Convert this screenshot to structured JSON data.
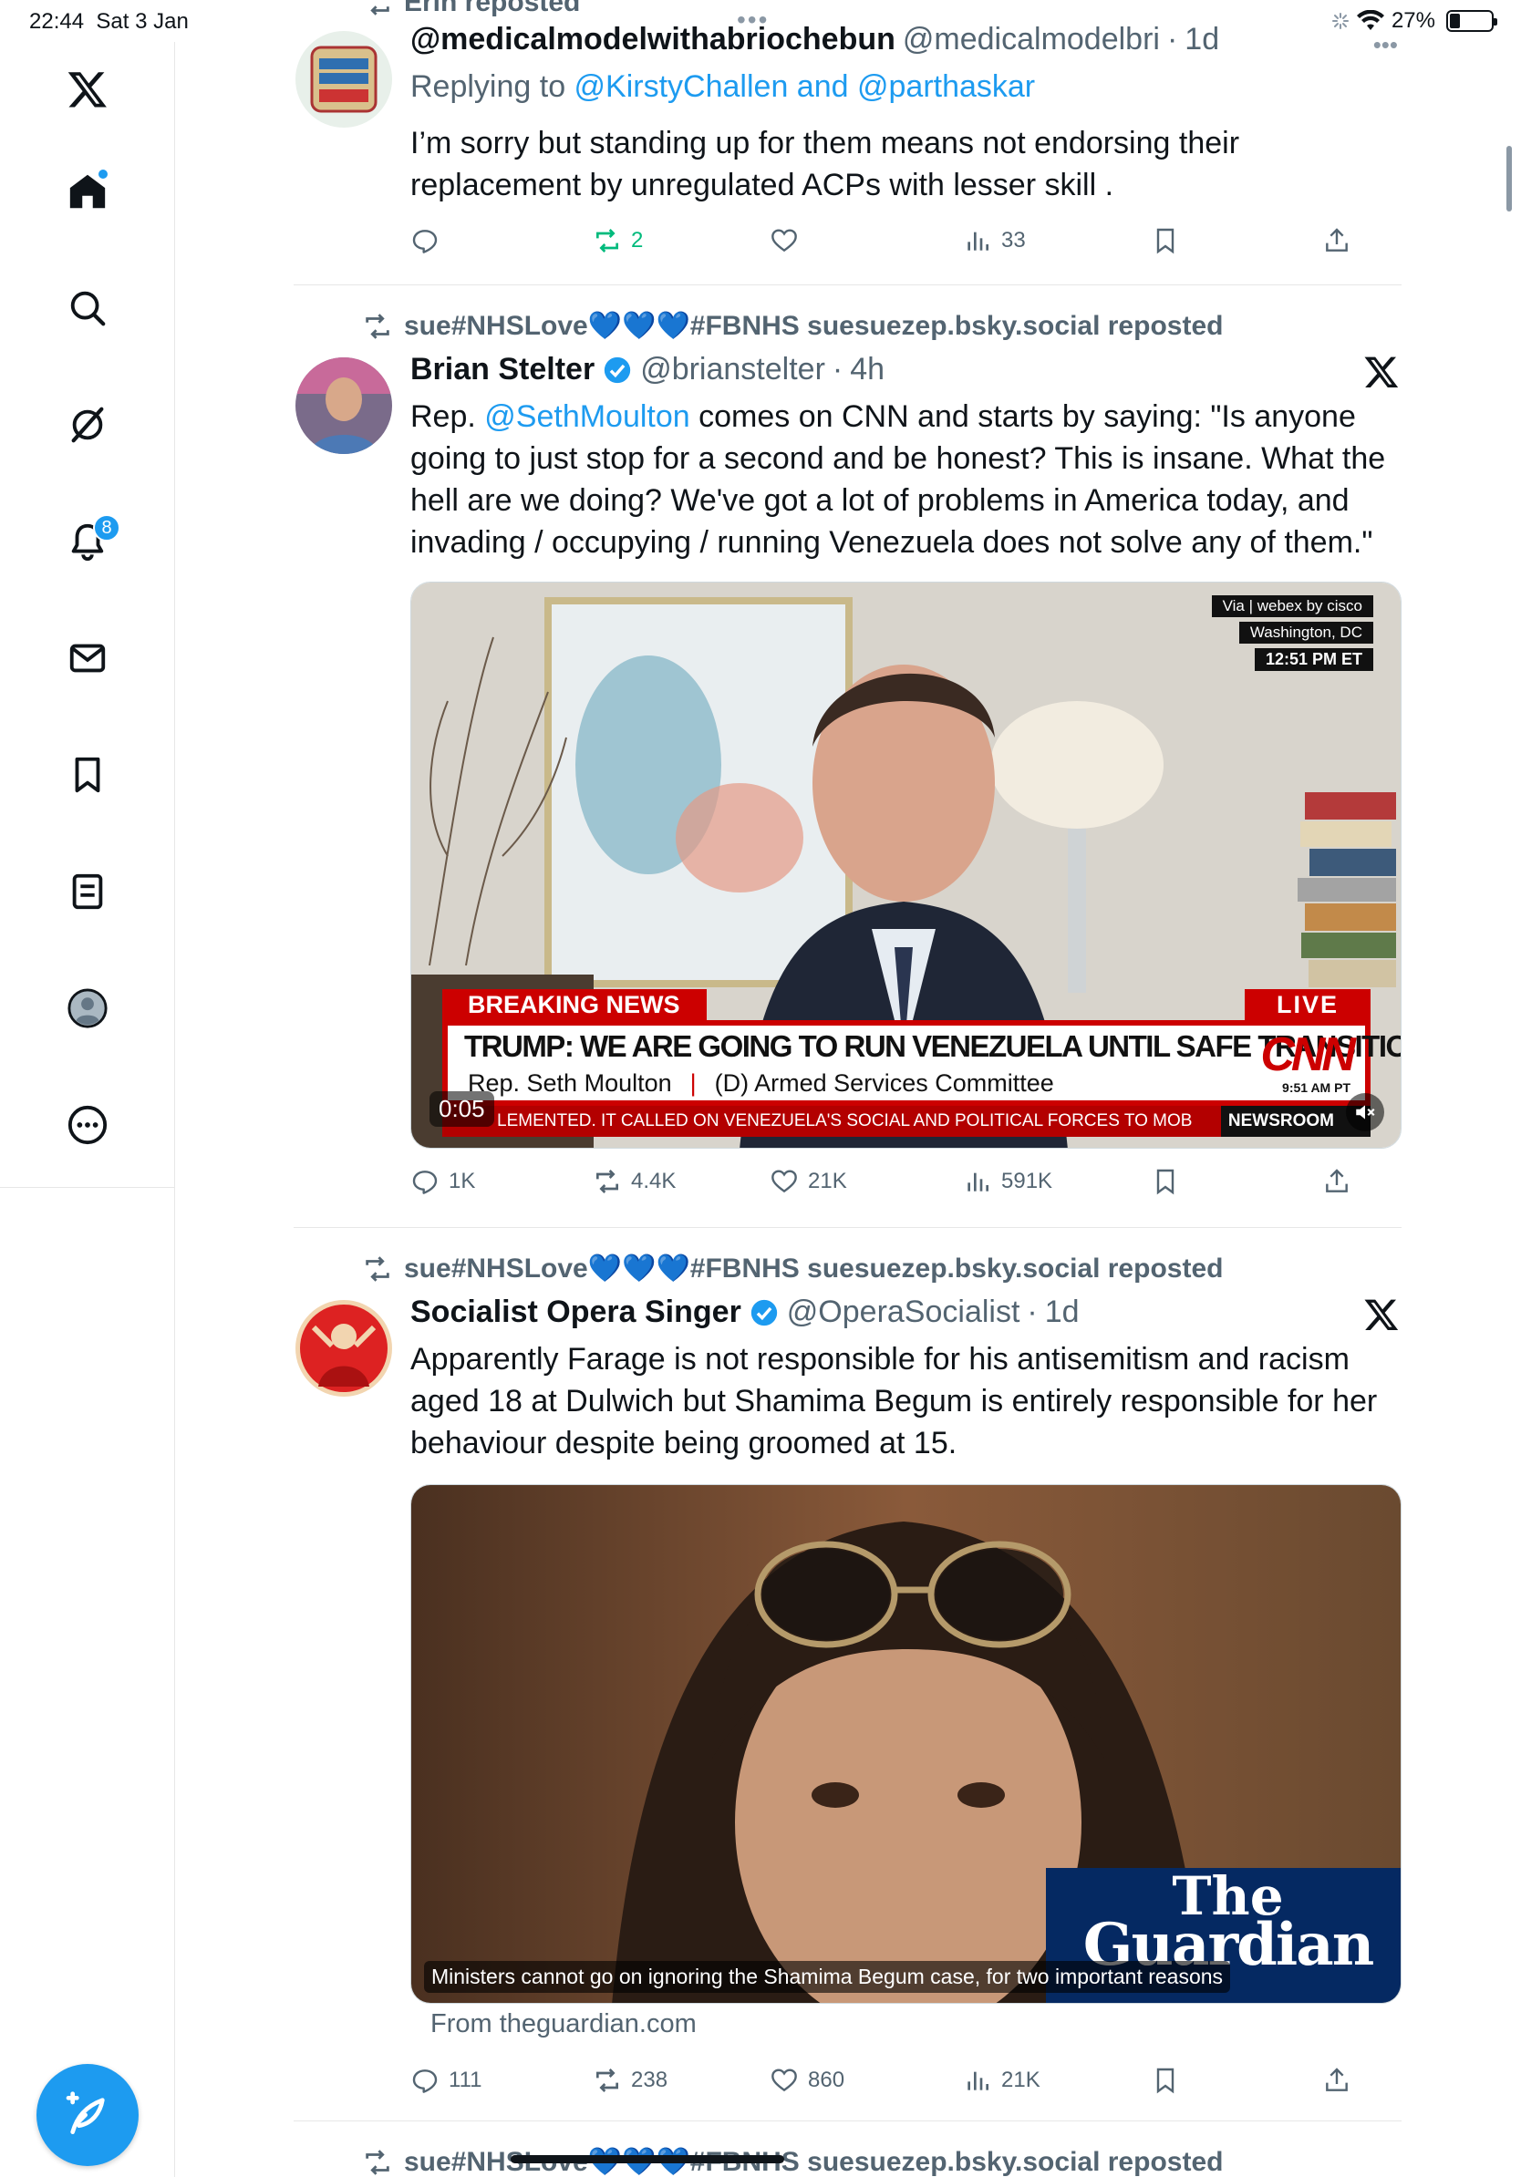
{
  "status_bar": {
    "time": "22:44",
    "date": "Sat 3 Jan",
    "battery": "27%"
  },
  "sidebar": {
    "items": [
      {
        "name": "x-logo"
      },
      {
        "name": "home",
        "badge_dot": true
      },
      {
        "name": "explore"
      },
      {
        "name": "grok"
      },
      {
        "name": "notifications",
        "badge": "8"
      },
      {
        "name": "messages"
      },
      {
        "name": "bookmarks"
      },
      {
        "name": "lists"
      },
      {
        "name": "profile"
      },
      {
        "name": "more"
      }
    ],
    "compose": "compose-post"
  },
  "posts": [
    {
      "repost_label": "Erin reposted",
      "display_name": "@medicalmodelwithabriochebun",
      "handle": "@medicalmodelbri",
      "time": "1d",
      "reply_to_prefix": "Replying to ",
      "reply_to": "@KirstyChallen and @parthaskar",
      "text": "I’m sorry but standing up for them means not endorsing their replacement by unregulated ACPs with lesser skill .",
      "replies": "",
      "reposts": "2",
      "likes": "",
      "views": "33"
    },
    {
      "repost_label": "sue#NHSLove💙💙💙#FBNHS suesuezep.bsky.social reposted",
      "display_name": "Brian Stelter",
      "handle": "@brianstelter",
      "time": "4h",
      "text_prefix": "Rep. ",
      "text_mention": "@SethMoulton",
      "text": " comes on CNN and starts by saying: \"Is anyone going to just stop for a second and be honest? This is insane. What the hell are we doing? We've got a lot of problems in America today, and invading / occupying / running Venezuela does not solve  any of them.\"",
      "video": {
        "via": "Via | webex by cisco",
        "location": "Washington, DC",
        "clock": "12:51 PM ET",
        "breaking": "BREAKING NEWS",
        "live": "LIVE",
        "headline": "TRUMP: WE ARE GOING TO RUN VENEZUELA UNTIL SAFE TRANSITION CAN TAKE PLACE",
        "name_line": "Rep. Seth Moulton",
        "role_line": "(D) Armed Services Committee",
        "network": "CNN",
        "pt_time": "9:51 AM PT",
        "ticker": "LEMENTED. IT CALLED ON VENEZUELA'S SOCIAL AND POLITICAL FORCES TO MOB",
        "ticker_brand": "NEWSROOM",
        "duration": "0:05"
      },
      "replies": "1K",
      "reposts": "4.4K",
      "likes": "21K",
      "views": "591K"
    },
    {
      "repost_label": "sue#NHSLove💙💙💙#FBNHS suesuezep.bsky.social reposted",
      "display_name": "Socialist Opera Singer",
      "handle": "@OperaSocialist",
      "time": "1d",
      "text": "Apparently Farage is not responsible for his antisemitism and racism aged 18 at Dulwich but Shamima Begum is entirely responsible for her behaviour despite being groomed at 15.",
      "card": {
        "caption": "Ministers cannot go on ignoring the Shamima Begum case, for two important reasons",
        "logo_line1": "The",
        "logo_line2": "Guardian",
        "source": "From theguardian.com"
      },
      "replies": "111",
      "reposts": "238",
      "likes": "860",
      "views": "21K"
    },
    {
      "repost_label": "sue#NHSLove💙💙💙#FBNHS suesuezep.bsky.social reposted"
    }
  ],
  "colors": {
    "accent": "#1d9bf0",
    "text": "#0f1419",
    "muted": "#536471",
    "repost_green": "#00ba7c",
    "cnn_red": "#cc0000"
  }
}
